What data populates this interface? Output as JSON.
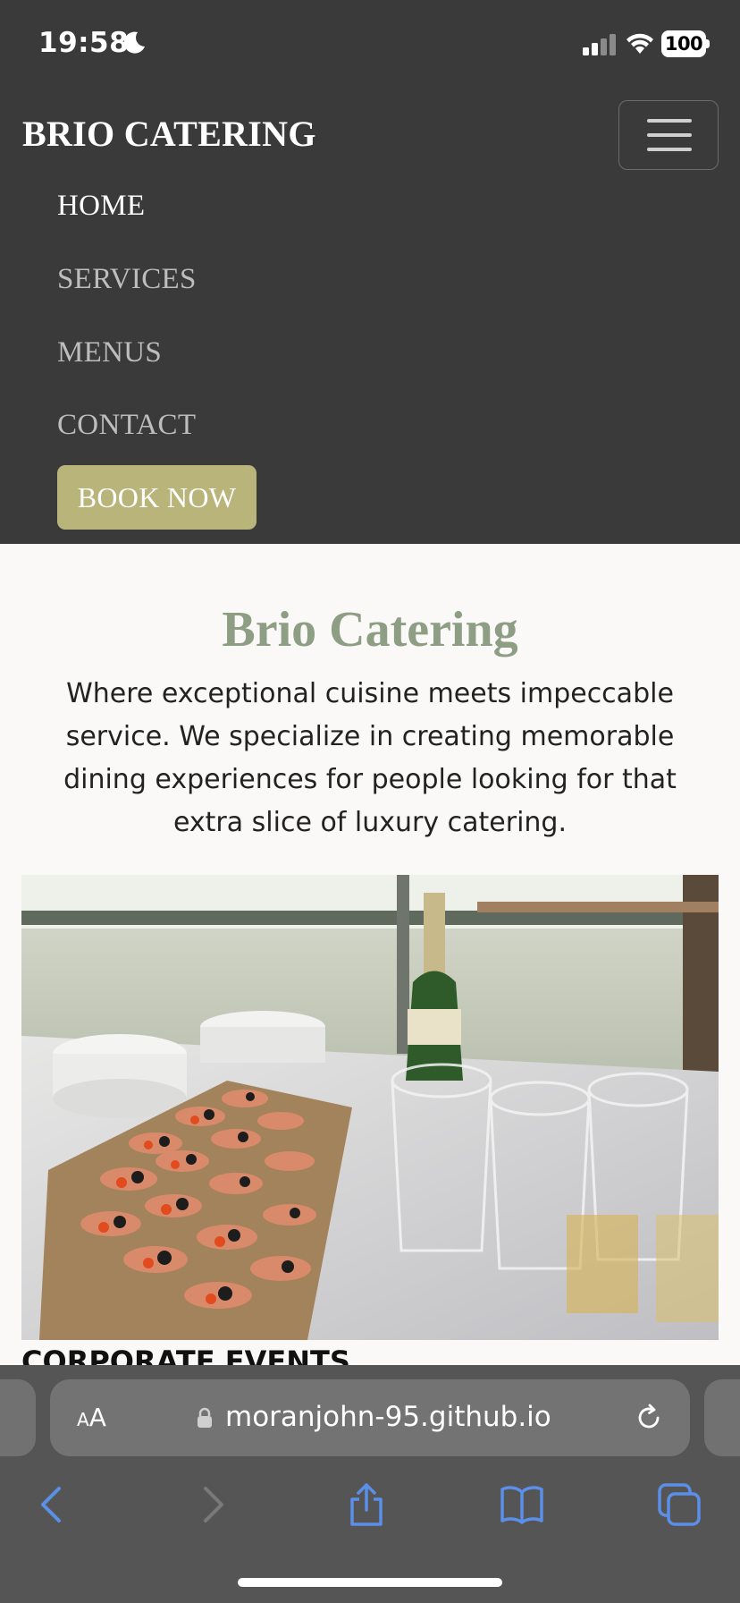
{
  "status_bar": {
    "time": "19:58",
    "battery": "100"
  },
  "navbar": {
    "brand": "BRIO CATERING",
    "links": [
      {
        "label": "HOME",
        "active": true
      },
      {
        "label": "SERVICES",
        "active": false
      },
      {
        "label": "MENUS",
        "active": false
      },
      {
        "label": "CONTACT",
        "active": false
      }
    ],
    "book_button": "BOOK NOW"
  },
  "hero": {
    "title": "Brio Catering",
    "text": "Where exceptional cuisine meets impeccable service. We specialize in creating memorable dining experiences for people looking for that extra slice of luxury catering."
  },
  "section": {
    "heading": "CORPORATE EVENTS"
  },
  "browser": {
    "text_size_small": "A",
    "text_size_big": "A",
    "url": "moranjohn-95.github.io"
  },
  "colors": {
    "nav_background": "#3a3a3a",
    "accent": "#b9b47a",
    "title": "#8e9e84",
    "browser_icon": "#5b8fe8"
  }
}
